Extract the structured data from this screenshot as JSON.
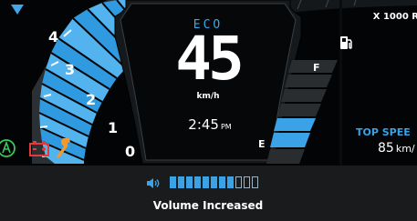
{
  "header": {
    "tach_scale_label": "X 1000 R"
  },
  "tachometer": {
    "ticks": [
      "0",
      "1",
      "2",
      "3",
      "4"
    ],
    "accent_color": "#43a6ea"
  },
  "center": {
    "ride_mode": "ECO",
    "speed": "45",
    "speed_unit": "km/h",
    "time": "2:45",
    "time_period": "PM"
  },
  "fuel": {
    "full_label": "F",
    "empty_label": "E",
    "level_fraction": 0.2
  },
  "top_speed": {
    "title": "TOP SPEE",
    "value": "85",
    "unit": "km/"
  },
  "indicators": [
    {
      "name": "auto-stop-icon",
      "color": "#37c95a"
    },
    {
      "name": "battery-warning-icon",
      "color": "#e53a3a"
    },
    {
      "name": "wrench-icon",
      "color": "#f29a2e"
    },
    {
      "name": "fuel-pump-icon",
      "color": "#ffffff"
    }
  ],
  "volume": {
    "label": "Volume Increased",
    "level": 8,
    "max": 11,
    "color": "#3aa2e6"
  }
}
